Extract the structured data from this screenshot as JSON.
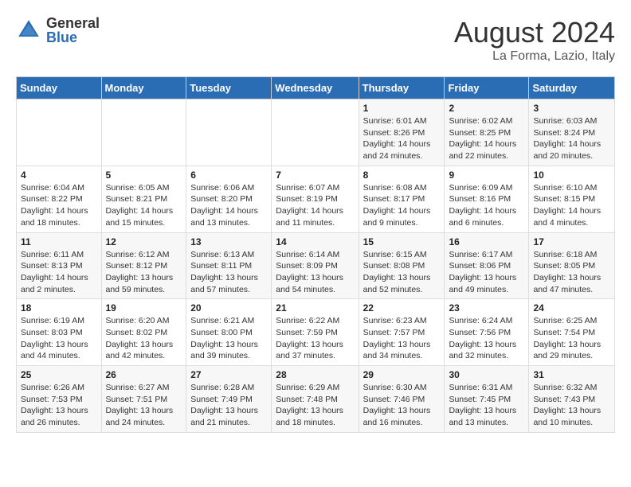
{
  "header": {
    "logo_general": "General",
    "logo_blue": "Blue",
    "month_year": "August 2024",
    "location": "La Forma, Lazio, Italy"
  },
  "days_of_week": [
    "Sunday",
    "Monday",
    "Tuesday",
    "Wednesday",
    "Thursday",
    "Friday",
    "Saturday"
  ],
  "weeks": [
    [
      {
        "day": "",
        "info": ""
      },
      {
        "day": "",
        "info": ""
      },
      {
        "day": "",
        "info": ""
      },
      {
        "day": "",
        "info": ""
      },
      {
        "day": "1",
        "info": "Sunrise: 6:01 AM\nSunset: 8:26 PM\nDaylight: 14 hours\nand 24 minutes."
      },
      {
        "day": "2",
        "info": "Sunrise: 6:02 AM\nSunset: 8:25 PM\nDaylight: 14 hours\nand 22 minutes."
      },
      {
        "day": "3",
        "info": "Sunrise: 6:03 AM\nSunset: 8:24 PM\nDaylight: 14 hours\nand 20 minutes."
      }
    ],
    [
      {
        "day": "4",
        "info": "Sunrise: 6:04 AM\nSunset: 8:22 PM\nDaylight: 14 hours\nand 18 minutes."
      },
      {
        "day": "5",
        "info": "Sunrise: 6:05 AM\nSunset: 8:21 PM\nDaylight: 14 hours\nand 15 minutes."
      },
      {
        "day": "6",
        "info": "Sunrise: 6:06 AM\nSunset: 8:20 PM\nDaylight: 14 hours\nand 13 minutes."
      },
      {
        "day": "7",
        "info": "Sunrise: 6:07 AM\nSunset: 8:19 PM\nDaylight: 14 hours\nand 11 minutes."
      },
      {
        "day": "8",
        "info": "Sunrise: 6:08 AM\nSunset: 8:17 PM\nDaylight: 14 hours\nand 9 minutes."
      },
      {
        "day": "9",
        "info": "Sunrise: 6:09 AM\nSunset: 8:16 PM\nDaylight: 14 hours\nand 6 minutes."
      },
      {
        "day": "10",
        "info": "Sunrise: 6:10 AM\nSunset: 8:15 PM\nDaylight: 14 hours\nand 4 minutes."
      }
    ],
    [
      {
        "day": "11",
        "info": "Sunrise: 6:11 AM\nSunset: 8:13 PM\nDaylight: 14 hours\nand 2 minutes."
      },
      {
        "day": "12",
        "info": "Sunrise: 6:12 AM\nSunset: 8:12 PM\nDaylight: 13 hours\nand 59 minutes."
      },
      {
        "day": "13",
        "info": "Sunrise: 6:13 AM\nSunset: 8:11 PM\nDaylight: 13 hours\nand 57 minutes."
      },
      {
        "day": "14",
        "info": "Sunrise: 6:14 AM\nSunset: 8:09 PM\nDaylight: 13 hours\nand 54 minutes."
      },
      {
        "day": "15",
        "info": "Sunrise: 6:15 AM\nSunset: 8:08 PM\nDaylight: 13 hours\nand 52 minutes."
      },
      {
        "day": "16",
        "info": "Sunrise: 6:17 AM\nSunset: 8:06 PM\nDaylight: 13 hours\nand 49 minutes."
      },
      {
        "day": "17",
        "info": "Sunrise: 6:18 AM\nSunset: 8:05 PM\nDaylight: 13 hours\nand 47 minutes."
      }
    ],
    [
      {
        "day": "18",
        "info": "Sunrise: 6:19 AM\nSunset: 8:03 PM\nDaylight: 13 hours\nand 44 minutes."
      },
      {
        "day": "19",
        "info": "Sunrise: 6:20 AM\nSunset: 8:02 PM\nDaylight: 13 hours\nand 42 minutes."
      },
      {
        "day": "20",
        "info": "Sunrise: 6:21 AM\nSunset: 8:00 PM\nDaylight: 13 hours\nand 39 minutes."
      },
      {
        "day": "21",
        "info": "Sunrise: 6:22 AM\nSunset: 7:59 PM\nDaylight: 13 hours\nand 37 minutes."
      },
      {
        "day": "22",
        "info": "Sunrise: 6:23 AM\nSunset: 7:57 PM\nDaylight: 13 hours\nand 34 minutes."
      },
      {
        "day": "23",
        "info": "Sunrise: 6:24 AM\nSunset: 7:56 PM\nDaylight: 13 hours\nand 32 minutes."
      },
      {
        "day": "24",
        "info": "Sunrise: 6:25 AM\nSunset: 7:54 PM\nDaylight: 13 hours\nand 29 minutes."
      }
    ],
    [
      {
        "day": "25",
        "info": "Sunrise: 6:26 AM\nSunset: 7:53 PM\nDaylight: 13 hours\nand 26 minutes."
      },
      {
        "day": "26",
        "info": "Sunrise: 6:27 AM\nSunset: 7:51 PM\nDaylight: 13 hours\nand 24 minutes."
      },
      {
        "day": "27",
        "info": "Sunrise: 6:28 AM\nSunset: 7:49 PM\nDaylight: 13 hours\nand 21 minutes."
      },
      {
        "day": "28",
        "info": "Sunrise: 6:29 AM\nSunset: 7:48 PM\nDaylight: 13 hours\nand 18 minutes."
      },
      {
        "day": "29",
        "info": "Sunrise: 6:30 AM\nSunset: 7:46 PM\nDaylight: 13 hours\nand 16 minutes."
      },
      {
        "day": "30",
        "info": "Sunrise: 6:31 AM\nSunset: 7:45 PM\nDaylight: 13 hours\nand 13 minutes."
      },
      {
        "day": "31",
        "info": "Sunrise: 6:32 AM\nSunset: 7:43 PM\nDaylight: 13 hours\nand 10 minutes."
      }
    ]
  ]
}
